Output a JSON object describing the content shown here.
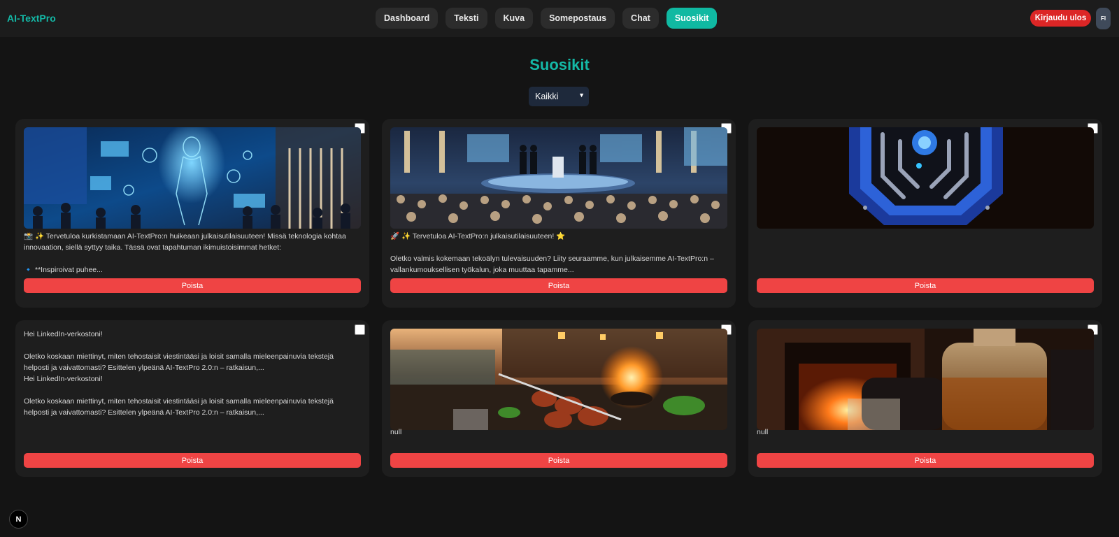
{
  "app": {
    "brand": "AI-TextPro"
  },
  "nav": {
    "items": [
      {
        "label": "Dashboard",
        "active": false
      },
      {
        "label": "Teksti",
        "active": false
      },
      {
        "label": "Kuva",
        "active": false
      },
      {
        "label": "Somepostaus",
        "active": false
      },
      {
        "label": "Chat",
        "active": false
      },
      {
        "label": "Suosikit",
        "active": true
      }
    ],
    "logout_label": "Kirjaudu ulos",
    "avatar_initials": "FI"
  },
  "page": {
    "title": "Suosikit",
    "filter": {
      "selected": "Kaikki"
    }
  },
  "cards": [
    {
      "image": "expo-hall-hologram",
      "lines": [
        "📸 ✨ Tervetuloa kurkistamaan AI-TextPro:n huikeaan julkaisutilaisuuteen! Missä teknologia kohtaa innovaation, siellä syttyy taika. Tässä ovat tapahtuman ikimuistoisimmat hetket:",
        "🔹 **Inspiroivat puhee..."
      ],
      "delete_label": "Poista"
    },
    {
      "image": "stage-audience",
      "lines": [
        "🚀 ✨ Tervetuloa AI-TextPro:n julkaisutilaisuuteen! ⭐",
        "Oletko valmis kokemaan tekoälyn tulevaisuuden? Liity seuraamme, kun julkaisemme AI-TextPro:n – vallankumouksellisen työkalun, joka muuttaa tapamme..."
      ],
      "delete_label": "Poista"
    },
    {
      "image": "circuit-logo",
      "lines": [],
      "delete_label": "Poista"
    },
    {
      "image": null,
      "lines": [
        "Hei LinkedIn-verkostoni!",
        "Oletko koskaan miettinyt, miten tehostaisit viestintääsi ja loisit samalla mieleenpainuvia tekstejä helposti ja vaivattomasti? Esittelen ylpeänä AI-TextPro 2.0:n – ratkaisun,...",
        "Hei LinkedIn-verkostoni!",
        "Oletko koskaan miettinyt, miten tehostaisit viestintääsi ja loisit samalla mieleenpainuvia tekstejä helposti ja vaivattomasti? Esittelen ylpeänä AI-TextPro 2.0:n – ratkaisun,..."
      ],
      "delete_label": "Poista"
    },
    {
      "image": "lakeside-grill",
      "lines": [
        "null"
      ],
      "delete_label": "Poista"
    },
    {
      "image": "fireplace-whisky",
      "lines": [
        "null"
      ],
      "delete_label": "Poista"
    }
  ],
  "fab_label": "N"
}
